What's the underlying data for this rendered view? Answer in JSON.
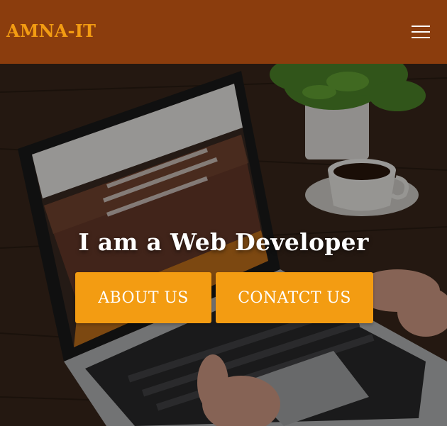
{
  "header": {
    "brand": "AMNA-IT",
    "menu_icon": "hamburger-menu-icon"
  },
  "hero": {
    "headline": "I am a Web Developer",
    "buttons": {
      "about_label": "ABOUT US",
      "contact_label": "CONATCT US"
    }
  },
  "colors": {
    "header_bg": "#8b3d0d",
    "brand": "#f39c12",
    "button_bg": "#f39c12",
    "button_text": "#ffffff"
  }
}
